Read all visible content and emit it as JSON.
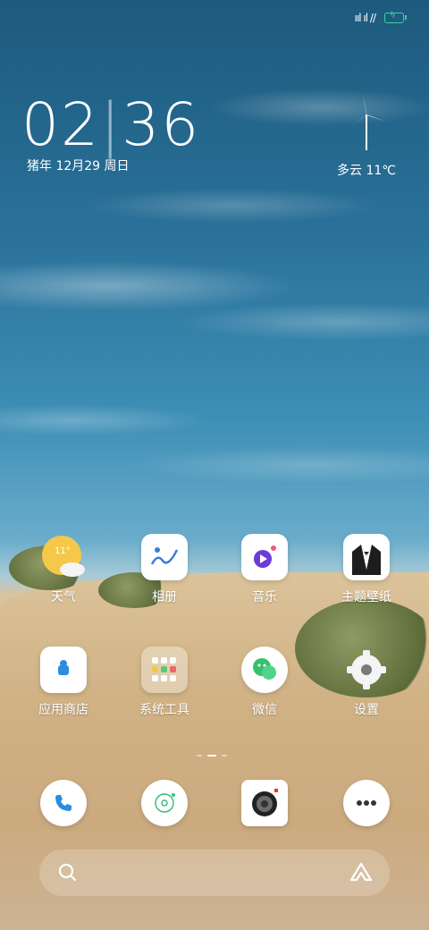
{
  "status": {
    "signal": "ııl ıl //",
    "battery_glyph": "ϟ",
    "accent": "#3bd0a0"
  },
  "clock": {
    "time": "02:36",
    "hours": "02",
    "minutes": "36",
    "date": "猪年 12月29 周日"
  },
  "weather_widget": {
    "text": "多云 11℃",
    "icon": "wind-turbine-icon"
  },
  "apps": [
    {
      "label": "天气",
      "icon": "weather-sun-cloud-icon",
      "badge": "11°"
    },
    {
      "label": "相册",
      "icon": "gallery-icon"
    },
    {
      "label": "音乐",
      "icon": "music-icon"
    },
    {
      "label": "主题壁纸",
      "icon": "theme-tuxedo-icon"
    },
    {
      "label": "应用商店",
      "icon": "app-store-icon"
    },
    {
      "label": "系统工具",
      "icon": "folder-icon"
    },
    {
      "label": "微信",
      "icon": "wechat-icon"
    },
    {
      "label": "设置",
      "icon": "settings-gear-icon"
    }
  ],
  "dock": [
    {
      "name": "phone",
      "icon": "phone-icon"
    },
    {
      "name": "browser",
      "icon": "browser-icon"
    },
    {
      "name": "camera",
      "icon": "camera-icon"
    },
    {
      "name": "messages",
      "icon": "messages-icon"
    }
  ],
  "pager": {
    "pages": 3,
    "active": 1
  },
  "search": {
    "icons": [
      "search-icon",
      "assistant-icon"
    ]
  }
}
